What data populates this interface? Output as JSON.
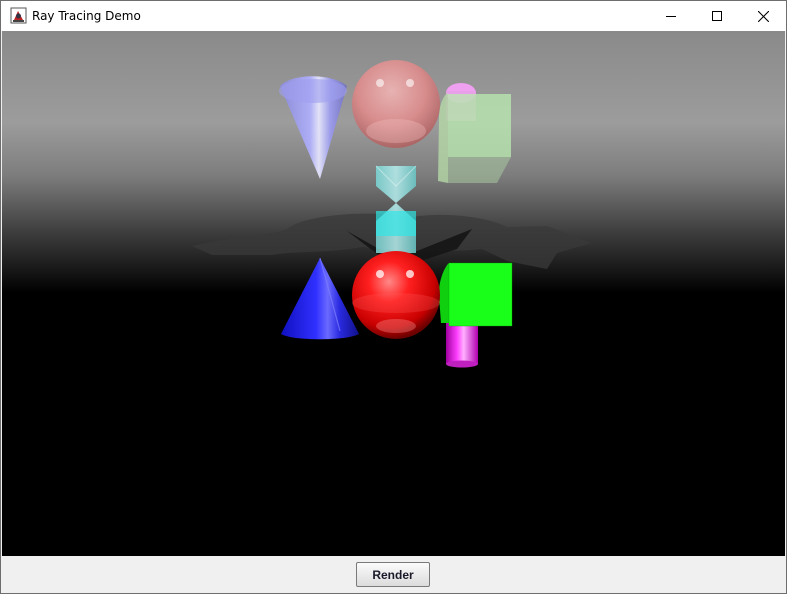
{
  "window": {
    "title": "Ray Tracing Demo",
    "icons": {
      "app": "java-app-icon",
      "minimize": "minimize-icon",
      "maximize": "maximize-icon",
      "close": "close-icon"
    }
  },
  "scene": {
    "description_objects": [
      "cone",
      "sphere",
      "cylinder",
      "hourglass",
      "cube"
    ],
    "colors": {
      "cone": "#2222ee",
      "sphere": "#ee1111",
      "cylinder": "#ee11ee",
      "hourglass": "#22dddd",
      "cube": "#11ee11",
      "floor": "#000000",
      "sky_top": "#8a8a8a",
      "sky_bottom": "#000000"
    }
  },
  "controls": {
    "render_label": "Render"
  }
}
